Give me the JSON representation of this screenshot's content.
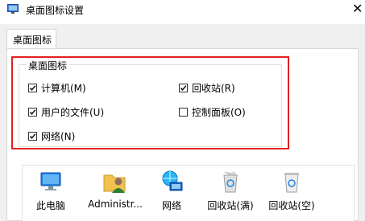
{
  "window": {
    "title": "桌面图标设置"
  },
  "tabs": [
    {
      "label": "桌面图标"
    }
  ],
  "group": {
    "label": "桌面图标",
    "checkboxes": [
      {
        "label": "计算机(M)",
        "checked": true
      },
      {
        "label": "回收站(R)",
        "checked": true
      },
      {
        "label": "用户的文件(U)",
        "checked": true
      },
      {
        "label": "控制面板(O)",
        "checked": false
      },
      {
        "label": "网络(N)",
        "checked": true
      }
    ]
  },
  "icons": [
    {
      "label": "此电脑",
      "icon": "computer-icon"
    },
    {
      "label": "Administr...",
      "icon": "user-folder-icon"
    },
    {
      "label": "网络",
      "icon": "network-icon"
    },
    {
      "label": "回收站(满)",
      "icon": "recycle-bin-full-icon"
    },
    {
      "label": "回收站(空)",
      "icon": "recycle-bin-empty-icon"
    }
  ],
  "colors": {
    "highlight": "#e02020",
    "dialog_bg": "#f0f0f0"
  }
}
